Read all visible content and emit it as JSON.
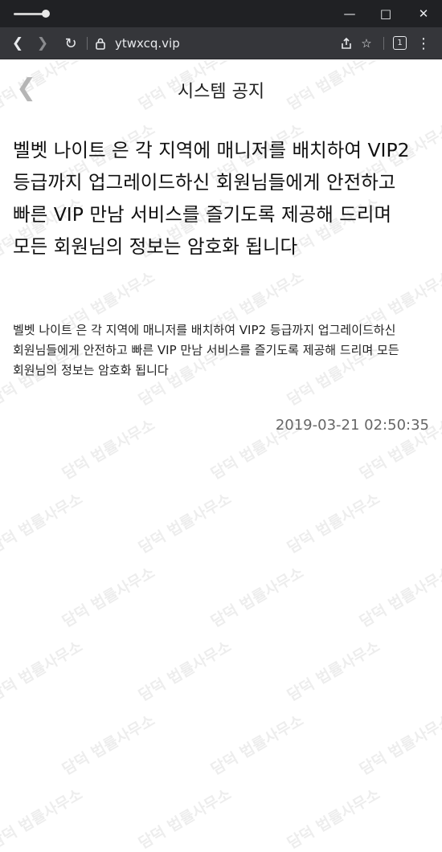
{
  "browser": {
    "url": "ytwxcq.vip",
    "tab_count": "1",
    "icons": {
      "minimize": "minimize-icon",
      "maximize": "maximize-icon",
      "close": "close-icon",
      "back": "arrow-left-icon",
      "forward": "arrow-right-icon",
      "reload": "reload-icon",
      "lock": "lock-icon",
      "share": "share-icon",
      "bookmark": "star-icon",
      "menu": "kebab-menu-icon"
    }
  },
  "page": {
    "title": "시스템 공지",
    "notice": {
      "headline": "벨벳 나이트 은 각 지역에 매니저를 배치하여 VIP2 등급까지 업그레이드하신 회원님들에게 안전하고 빠른 VIP 만남 서비스를 즐기도록 제공해 드리며 모든 회원님의 정보는 암호화 됩니다",
      "body": "벨벳 나이트 은 각 지역에 매니저를 배치하여 VIP2 등급까지 업그레이드하신 회원님들에게 안전하고 빠른 VIP 만남 서비스를 즐기도록 제공해 드리며 모든 회원님의 정보는 암호화 됩니다",
      "timestamp": "2019-03-21 02:50:35"
    }
  },
  "watermark": {
    "text": "담덕 법률사무소"
  }
}
